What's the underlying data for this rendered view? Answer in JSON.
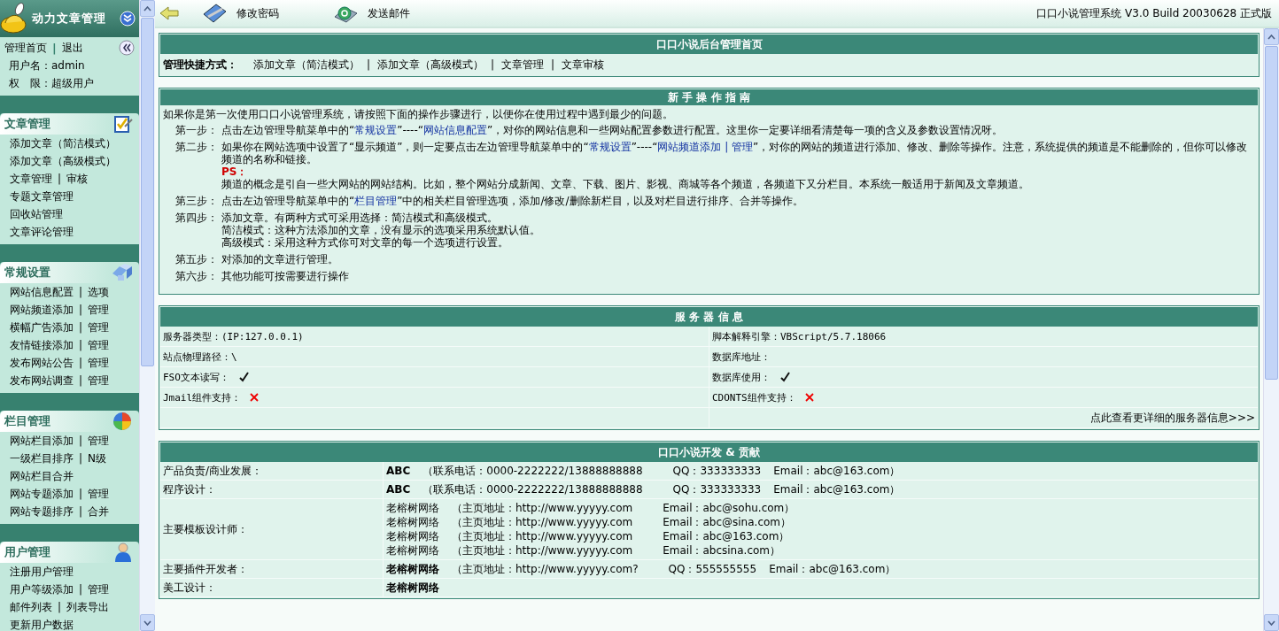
{
  "sidebar": {
    "title": "动力文章管理",
    "home": "管理首页",
    "separator": "|",
    "logout": "退出",
    "user_lines": [
      "用户名：admin",
      "权　限：超级用户"
    ],
    "sections": [
      {
        "title": "文章管理",
        "items": [
          {
            "links": [
              "添加文章（简洁模式）"
            ]
          },
          {
            "links": [
              "添加文章（高级模式）"
            ]
          },
          {
            "links": [
              "文章管理",
              "审核"
            ]
          },
          {
            "links": [
              "专题文章管理"
            ]
          },
          {
            "links": [
              "回收站管理"
            ]
          },
          {
            "links": [
              "文章评论管理"
            ]
          }
        ]
      },
      {
        "title": "常规设置",
        "items": [
          {
            "links": [
              "网站信息配置",
              "选项"
            ]
          },
          {
            "links": [
              "网站频道添加",
              "管理"
            ]
          },
          {
            "links": [
              "横幅广告添加",
              "管理"
            ]
          },
          {
            "links": [
              "友情链接添加",
              "管理"
            ]
          },
          {
            "links": [
              "发布网站公告",
              "管理"
            ]
          },
          {
            "links": [
              "发布网站调查",
              "管理"
            ]
          }
        ]
      },
      {
        "title": "栏目管理",
        "items": [
          {
            "links": [
              "网站栏目添加",
              "管理"
            ]
          },
          {
            "links": [
              "一级栏目排序",
              "N级"
            ]
          },
          {
            "links": [
              "网站栏目合并"
            ]
          },
          {
            "links": [
              "网站专题添加",
              "管理"
            ]
          },
          {
            "links": [
              "网站专题排序",
              "合并"
            ]
          }
        ]
      },
      {
        "title": "用户管理",
        "items": [
          {
            "links": [
              "注册用户管理"
            ]
          },
          {
            "links": [
              "用户等级添加",
              "管理"
            ]
          },
          {
            "links": [
              "邮件列表",
              "列表导出"
            ]
          },
          {
            "links": [
              "更新用户数据"
            ]
          }
        ]
      }
    ]
  },
  "toolbar": {
    "items": [
      {
        "label": "修改密码"
      },
      {
        "label": "发送邮件"
      }
    ],
    "version": "口口小说管理系统 V3.0 Build 20030628 正式版"
  },
  "home_box": {
    "title": "口口小说后台管理首页",
    "shortcut_label": "管理快捷方式：",
    "separator": "|",
    "shortcuts": [
      "添加文章（简洁模式）",
      "添加文章（高级模式）",
      "文章管理",
      "文章审核"
    ]
  },
  "guide": {
    "title": "新 手 操 作 指 南",
    "intro": "如果你是第一次使用口口小说管理系统，请按照下面的操作步骤进行，以便你在使用过程中遇到最少的问题。",
    "steps": [
      {
        "label": "第一步：",
        "paragraphs": [
          [
            {
              "kind": "plain",
              "text": "点击左边管理导航菜单中的“"
            },
            {
              "kind": "link",
              "text": "常规设置"
            },
            {
              "kind": "plain",
              "text": "”----“"
            },
            {
              "kind": "link",
              "text": "网站信息配置"
            },
            {
              "kind": "plain",
              "text": "”，对你的网站信息和一些网站配置参数进行配置。这里你一定要详细看清楚每一项的含义及参数设置情况呀。"
            }
          ]
        ]
      },
      {
        "label": "第二步：",
        "paragraphs": [
          [
            {
              "kind": "plain",
              "text": "如果你在网站选项中设置了“显示频道”，则一定要点击左边管理导航菜单中的“"
            },
            {
              "kind": "link",
              "text": "常规设置"
            },
            {
              "kind": "plain",
              "text": "”----“"
            },
            {
              "kind": "link",
              "text": "网站频道添加 | 管理"
            },
            {
              "kind": "plain",
              "text": "”，对你的网站的频道进行添加、修改、删除等操作。注意，系统提供的频道是不能删除的，但你可以修改频道的名称和链接。"
            }
          ],
          [
            {
              "kind": "ps",
              "text": "PS："
            }
          ],
          [
            {
              "kind": "plain",
              "text": "频道的概念是引自一些大网站的网站结构。比如，整个网站分成新闻、文章、下载、图片、影视、商城等各个频道，各频道下又分栏目。本系统一般适用于新闻及文章频道。"
            }
          ]
        ]
      },
      {
        "label": "第三步：",
        "paragraphs": [
          [
            {
              "kind": "plain",
              "text": "点击左边管理导航菜单中的“"
            },
            {
              "kind": "link",
              "text": "栏目管理"
            },
            {
              "kind": "plain",
              "text": "”中的相关栏目管理选项，添加/修改/删除新栏目，以及对栏目进行排序、合并等操作。"
            }
          ]
        ]
      },
      {
        "label": "第四步：",
        "paragraphs": [
          [
            {
              "kind": "plain",
              "text": "添加文章。有两种方式可采用选择：简洁模式和高级模式。"
            }
          ],
          [
            {
              "kind": "plain",
              "text": "简洁模式：这种方法添加的文章，没有显示的选项采用系统默认值。"
            }
          ],
          [
            {
              "kind": "plain",
              "text": "高级模式：采用这种方式你可对文章的每一个选项进行设置。"
            }
          ]
        ]
      },
      {
        "label": "第五步：",
        "paragraphs": [
          [
            {
              "kind": "plain",
              "text": "对添加的文章进行管理。"
            }
          ]
        ]
      },
      {
        "label": "第六步：",
        "paragraphs": [
          [
            {
              "kind": "plain",
              "text": "其他功能可按需要进行操作"
            }
          ]
        ]
      }
    ]
  },
  "server": {
    "title": "服 务 器 信 息",
    "rows": [
      [
        {
          "kind": "text",
          "text": "服务器类型：(IP:127.0.0.1)"
        },
        {
          "kind": "text",
          "text": "脚本解释引擎：VBScript/5.7.18066"
        }
      ],
      [
        {
          "kind": "text",
          "text": "站点物理路径：\\"
        },
        {
          "kind": "text",
          "text": "数据库地址："
        }
      ],
      [
        {
          "kind": "status",
          "text": "FSO文本读写：",
          "supported": true
        },
        {
          "kind": "status",
          "text": "数据库使用：",
          "supported": true
        }
      ],
      [
        {
          "kind": "status",
          "text": "Jmail组件支持：",
          "supported": false
        },
        {
          "kind": "status",
          "text": "CDONTS组件支持：",
          "supported": false
        }
      ]
    ],
    "more_link": "点此查看更详细的服务器信息>>>"
  },
  "credits": {
    "title": "口口小说开发 & 贡献",
    "rows": [
      {
        "label": "产品负责/商业发展：",
        "lines": [
          [
            {
              "text": "ABC",
              "bold": true
            },
            {
              "text": "（联系电话：0000-2222222/13888888888",
              "bold": false
            },
            {
              "text": "QQ：333333333",
              "bold": false
            },
            {
              "text": "Email：abc@163.com）",
              "bold": false
            }
          ]
        ]
      },
      {
        "label": "程序设计：",
        "lines": [
          [
            {
              "text": "ABC",
              "bold": true
            },
            {
              "text": "（联系电话：0000-2222222/13888888888",
              "bold": false
            },
            {
              "text": "QQ：333333333",
              "bold": false
            },
            {
              "text": "Email：abc@163.com）",
              "bold": false
            }
          ]
        ]
      },
      {
        "label": "主要模板设计师：",
        "lines": [
          [
            {
              "text": "老榕树网络",
              "bold": false
            },
            {
              "text": "（主页地址：http://www.yyyyy.com",
              "bold": false
            },
            {
              "text": "Email：abc@sohu.com）",
              "bold": false
            }
          ],
          [
            {
              "text": "老榕树网络",
              "bold": false
            },
            {
              "text": "（主页地址：http://www.yyyyy.com",
              "bold": false
            },
            {
              "text": "Email：abc@sina.com）",
              "bold": false
            }
          ],
          [
            {
              "text": "老榕树网络",
              "bold": false
            },
            {
              "text": "（主页地址：http://www.yyyyy.com",
              "bold": false
            },
            {
              "text": "Email：abc@163.com）",
              "bold": false
            }
          ],
          [
            {
              "text": "老榕树网络",
              "bold": false
            },
            {
              "text": "（主页地址：http://www.yyyyy.com",
              "bold": false
            },
            {
              "text": "Email：abcsina.com）",
              "bold": false
            }
          ]
        ]
      },
      {
        "label": "主要插件开发者：",
        "lines": [
          [
            {
              "text": "老榕树网络",
              "bold": true
            },
            {
              "text": "（主页地址：http://www.yyyyy.com?",
              "bold": false
            },
            {
              "text": "QQ：555555555",
              "bold": false
            },
            {
              "text": "Email：abc@163.com）",
              "bold": false
            }
          ]
        ]
      },
      {
        "label": "美工设计：",
        "lines": [
          [
            {
              "text": "老榕树网络",
              "bold": true
            }
          ]
        ]
      }
    ]
  }
}
